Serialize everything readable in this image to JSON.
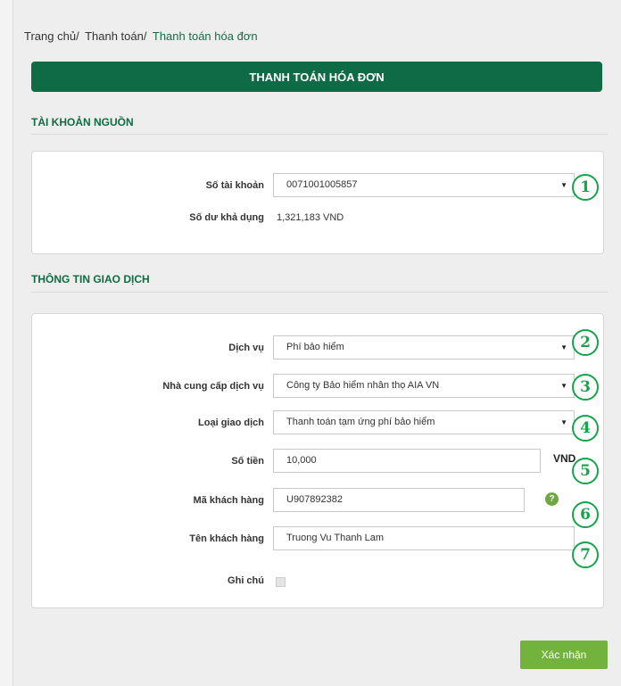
{
  "breadcrumb": {
    "home": "Trang chủ",
    "payment": "Thanh toán",
    "current": "Thanh toán hóa đơn",
    "separator": "/"
  },
  "banner": {
    "title": "THANH TOÁN HÓA ĐƠN"
  },
  "source_account": {
    "title": "TÀI KHOẢN NGUỒN",
    "account_label": "Số tài khoản",
    "account_value": "0071001005857",
    "balance_label": "Số dư khả dụng",
    "balance_value": "1,321,183 VND"
  },
  "transaction": {
    "title": "THÔNG TIN GIAO DỊCH",
    "service_label": "Dịch vụ",
    "service_value": "Phí bảo hiểm",
    "provider_label": "Nhà cung cấp dịch vụ",
    "provider_value": "Công ty Bảo hiểm nhân thọ AIA VN",
    "type_label": "Loại giao dịch",
    "type_value": "Thanh toán tạm ứng phí bảo hiểm",
    "amount_label": "Số tiền",
    "amount_value": "10,000",
    "amount_unit": "VND",
    "customer_code_label": "Mã khách hàng",
    "customer_code_value": "U907892382",
    "help_glyph": "?",
    "customer_name_label": "Tên khách hàng",
    "customer_name_value": "Truong Vu Thanh Lam",
    "note_label": "Ghi chú"
  },
  "markers": [
    "1",
    "2",
    "3",
    "4",
    "5",
    "6",
    "7"
  ],
  "actions": {
    "confirm_label": "Xác nhận"
  },
  "colors": {
    "banner": "#0e6b45",
    "marker": "#18a34a",
    "confirm": "#71b33c",
    "help": "#6fa742"
  }
}
